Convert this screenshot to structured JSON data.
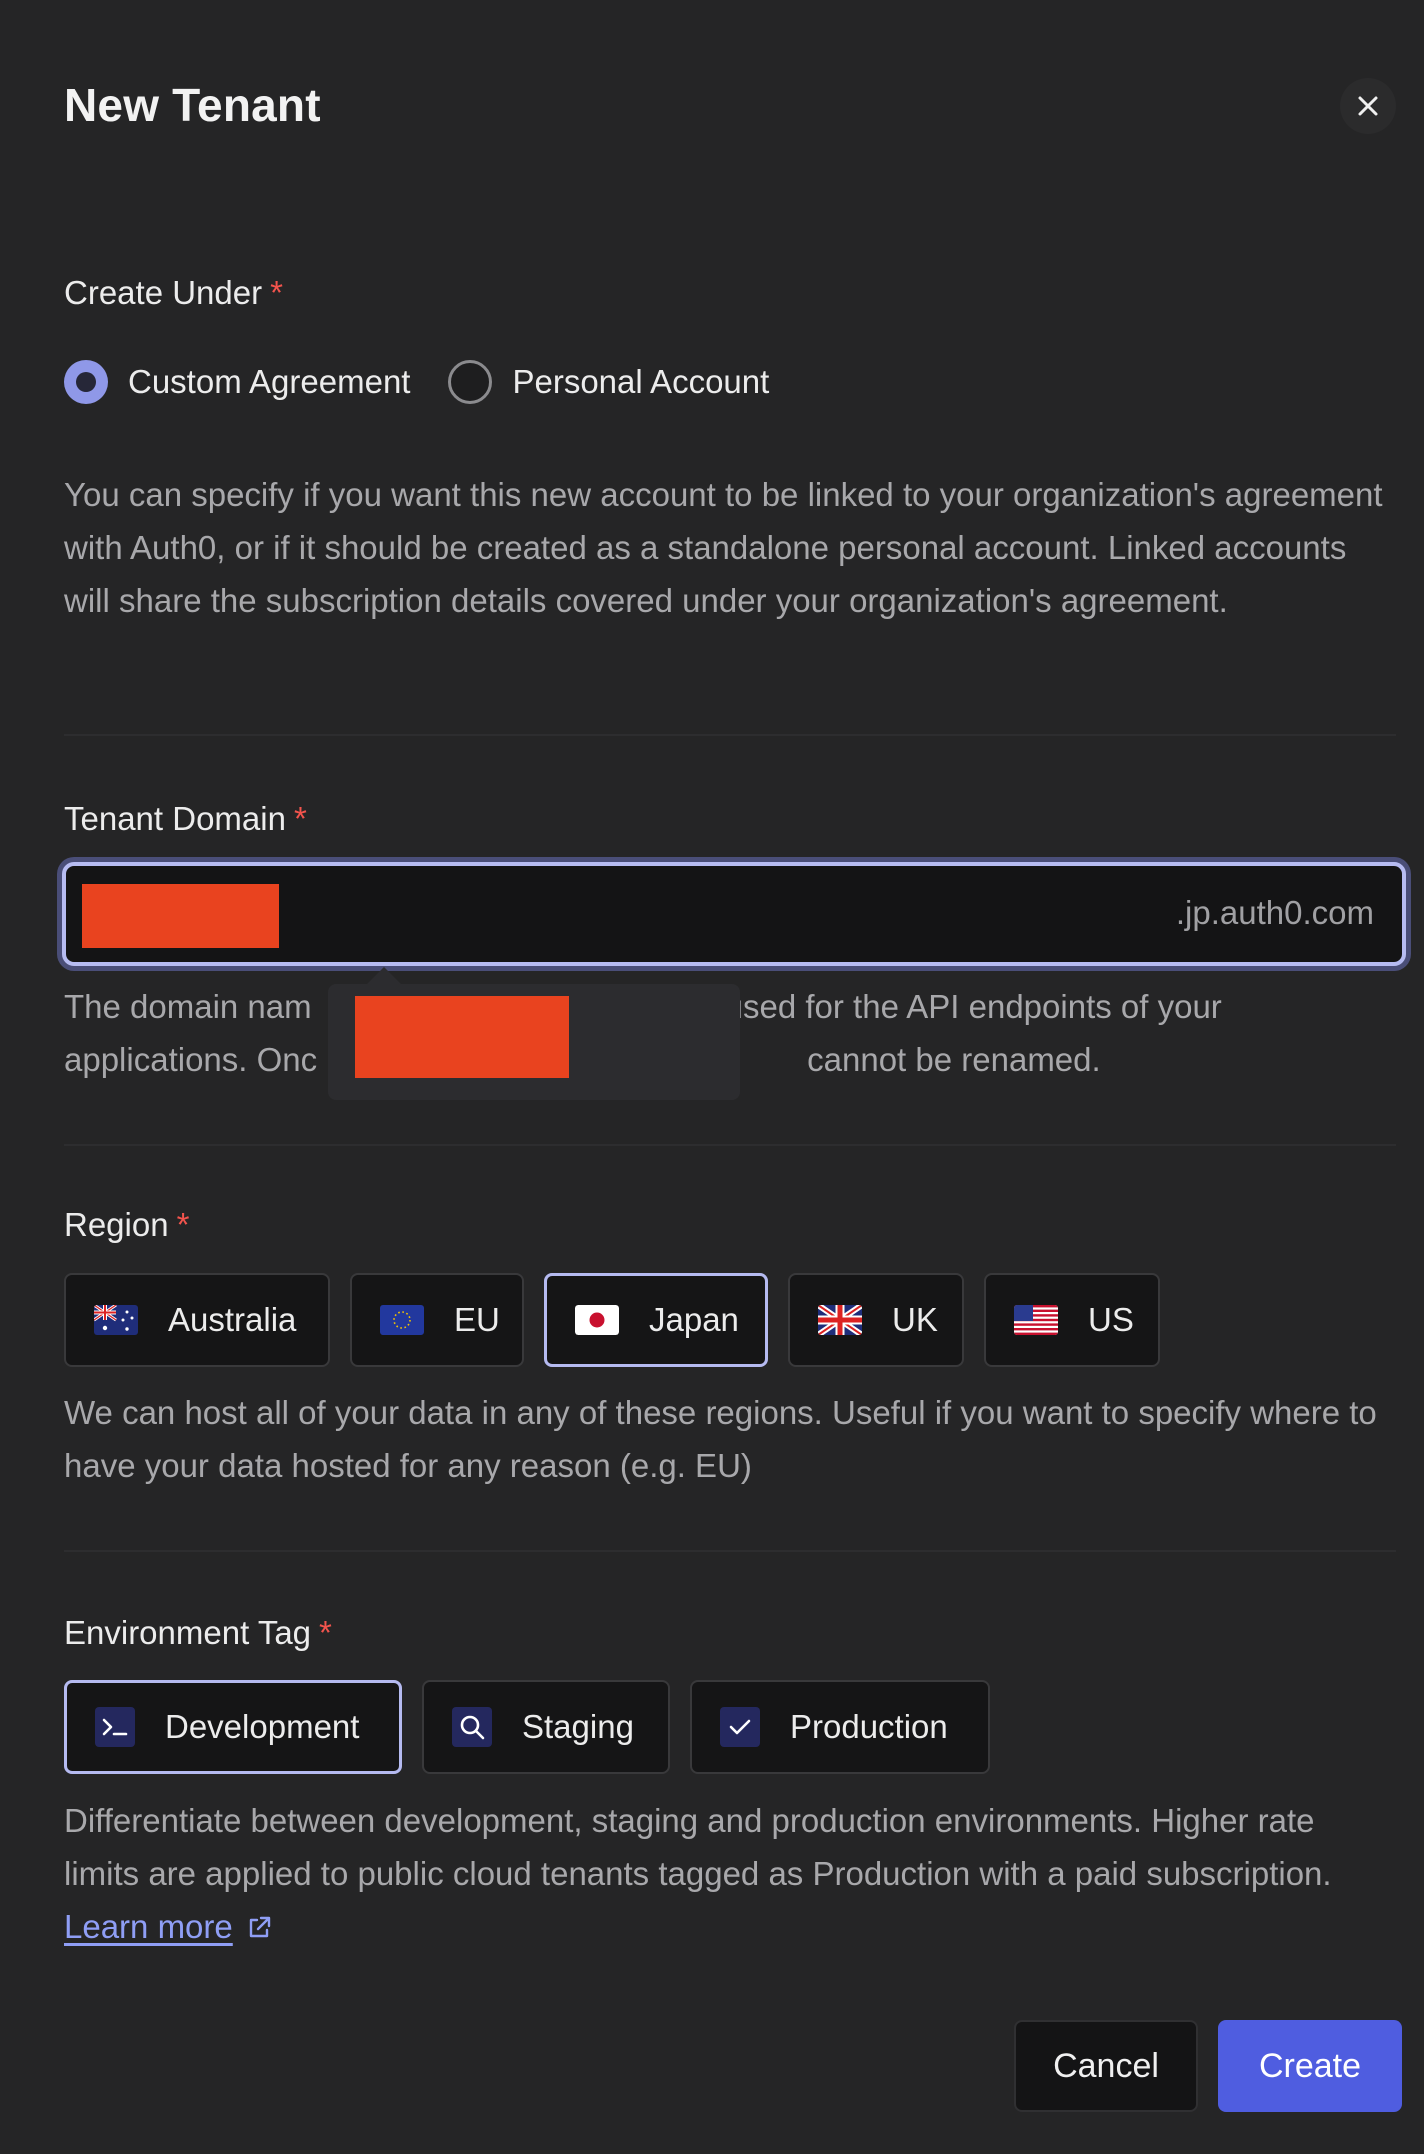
{
  "dialog": {
    "title": "New Tenant",
    "close_icon": "close-icon"
  },
  "create_under": {
    "label": "Create Under",
    "required_mark": "*",
    "options": [
      {
        "label": "Custom Agreement",
        "selected": true
      },
      {
        "label": "Personal Account",
        "selected": false
      }
    ],
    "help": "You can specify if you want this new account to be linked to your organization's agreement with Auth0, or if it should be created as a standalone personal account. Linked accounts will share the subscription details covered under your organization's agreement."
  },
  "tenant_domain": {
    "label": "Tenant Domain",
    "required_mark": "*",
    "suffix": ".jp.auth0.com",
    "help_part1": "The domain nam",
    "help_part2": "used for the API endpoints of your",
    "help_part3": "applications. Onc",
    "help_part4": "cannot be renamed."
  },
  "region": {
    "label": "Region",
    "required_mark": "*",
    "options": [
      {
        "label": "Australia",
        "icon": "australia-flag-icon",
        "selected": false
      },
      {
        "label": "EU",
        "icon": "eu-flag-icon",
        "selected": false
      },
      {
        "label": "Japan",
        "icon": "japan-flag-icon",
        "selected": true
      },
      {
        "label": "UK",
        "icon": "uk-flag-icon",
        "selected": false
      },
      {
        "label": "US",
        "icon": "us-flag-icon",
        "selected": false
      }
    ],
    "help": "We can host all of your data in any of these regions. Useful if you want to specify where to have your data hosted for any reason (e.g. EU)"
  },
  "environment_tag": {
    "label": "Environment Tag",
    "required_mark": "*",
    "options": [
      {
        "label": "Development",
        "icon": "terminal-icon",
        "selected": true
      },
      {
        "label": "Staging",
        "icon": "search-icon",
        "selected": false
      },
      {
        "label": "Production",
        "icon": "checkmark-icon",
        "selected": false
      }
    ],
    "help": "Differentiate between development, staging and production environments. Higher rate limits are applied to public cloud tenants tagged as Production with a paid subscription.",
    "learn_more": "Learn more"
  },
  "footer": {
    "cancel_label": "Cancel",
    "create_label": "Create"
  },
  "colors": {
    "background": "#252526",
    "accent": "#4f5de0",
    "selected_border": "#b5baf0",
    "required": "#f3544d",
    "link": "#8f9ef5",
    "redaction": "#e9431f"
  }
}
